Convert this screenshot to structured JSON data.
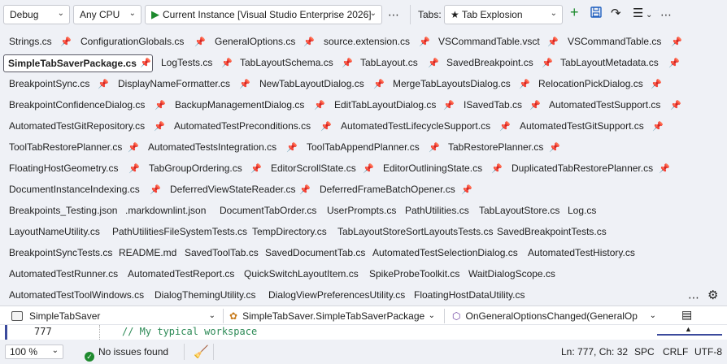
{
  "toolbar": {
    "config": "Debug",
    "platform": "Any CPU",
    "run_target": "Current Instance [Visual Studio Enterprise 2026]",
    "tabs_label": "Tabs:",
    "tab_set": "★ Tab Explosion"
  },
  "tab_rows": [
    [
      {
        "label": "Strings.cs",
        "pinned": true
      },
      {
        "label": "ConfigurationGlobals.cs",
        "pinned": true
      },
      {
        "label": "GeneralOptions.cs",
        "pinned": true
      },
      {
        "label": "source.extension.cs",
        "pinned": true
      },
      {
        "label": "VSCommandTable.vsct",
        "pinned": true
      },
      {
        "label": "VSCommandTable.cs",
        "pinned": true
      }
    ],
    [
      {
        "label": "SimpleTabSaverPackage.cs",
        "pinned": true,
        "active": true
      },
      {
        "label": "LogTests.cs",
        "pinned": true
      },
      {
        "label": "TabLayoutSchema.cs",
        "pinned": true
      },
      {
        "label": "TabLayout.cs",
        "pinned": true
      },
      {
        "label": "SavedBreakpoint.cs",
        "pinned": true
      },
      {
        "label": "TabLayoutMetadata.cs",
        "pinned": true
      }
    ],
    [
      {
        "label": "BreakpointSync.cs",
        "pinned": true
      },
      {
        "label": "DisplayNameFormatter.cs",
        "pinned": true
      },
      {
        "label": "NewTabLayoutDialog.cs",
        "pinned": true
      },
      {
        "label": "MergeTabLayoutsDialog.cs",
        "pinned": true
      },
      {
        "label": "RelocationPickDialog.cs",
        "pinned": true
      }
    ],
    [
      {
        "label": "BreakpointConfidenceDialog.cs",
        "pinned": true
      },
      {
        "label": "BackupManagementDialog.cs",
        "pinned": true
      },
      {
        "label": "EditTabLayoutDialog.cs",
        "pinned": true
      },
      {
        "label": "ISavedTab.cs",
        "pinned": true
      },
      {
        "label": "AutomatedTestSupport.cs",
        "pinned": true
      }
    ],
    [
      {
        "label": "AutomatedTestGitRepository.cs",
        "pinned": true
      },
      {
        "label": "AutomatedTestPreconditions.cs",
        "pinned": true
      },
      {
        "label": "AutomatedTestLifecycleSupport.cs",
        "pinned": true
      },
      {
        "label": "AutomatedTestGitSupport.cs",
        "pinned": true
      }
    ],
    [
      {
        "label": "ToolTabRestorePlanner.cs",
        "pinned": true
      },
      {
        "label": "AutomatedTestsIntegration.cs",
        "pinned": true
      },
      {
        "label": "ToolTabAppendPlanner.cs",
        "pinned": true
      },
      {
        "label": "TabRestorePlanner.cs",
        "pinned": true
      }
    ],
    [
      {
        "label": "FloatingHostGeometry.cs",
        "pinned": true
      },
      {
        "label": "TabGroupOrdering.cs",
        "pinned": true
      },
      {
        "label": "EditorScrollState.cs",
        "pinned": true
      },
      {
        "label": "EditorOutliningState.cs",
        "pinned": true
      },
      {
        "label": "DuplicatedTabRestorePlanner.cs",
        "pinned": true
      }
    ],
    [
      {
        "label": "DocumentInstanceIndexing.cs",
        "pinned": true
      },
      {
        "label": "DeferredViewStateReader.cs",
        "pinned": true
      },
      {
        "label": "DeferredFrameBatchOpener.cs",
        "pinned": true
      }
    ],
    [
      {
        "label": "Breakpoints_Testing.json",
        "pinned": false
      },
      {
        "label": ".markdownlint.json",
        "pinned": false
      },
      {
        "label": "DocumentTabOrder.cs",
        "pinned": false
      },
      {
        "label": "UserPrompts.cs",
        "pinned": false
      },
      {
        "label": "PathUtilities.cs",
        "pinned": false
      },
      {
        "label": "TabLayoutStore.cs",
        "pinned": false
      },
      {
        "label": "Log.cs",
        "pinned": false
      }
    ],
    [
      {
        "label": "LayoutNameUtility.cs",
        "pinned": false
      },
      {
        "label": "PathUtilitiesFileSystemTests.cs",
        "pinned": false
      },
      {
        "label": "TempDirectory.cs",
        "pinned": false
      },
      {
        "label": "TabLayoutStoreSortLayoutsTests.cs",
        "pinned": false
      },
      {
        "label": "SavedBreakpointTests.cs",
        "pinned": false
      }
    ],
    [
      {
        "label": "BreakpointSyncTests.cs",
        "pinned": false
      },
      {
        "label": "README.md",
        "pinned": false
      },
      {
        "label": "SavedToolTab.cs",
        "pinned": false
      },
      {
        "label": "SavedDocumentTab.cs",
        "pinned": false
      },
      {
        "label": "AutomatedTestSelectionDialog.cs",
        "pinned": false
      },
      {
        "label": "AutomatedTestHistory.cs",
        "pinned": false
      }
    ],
    [
      {
        "label": "AutomatedTestRunner.cs",
        "pinned": false
      },
      {
        "label": "AutomatedTestReport.cs",
        "pinned": false
      },
      {
        "label": "QuickSwitchLayoutItem.cs",
        "pinned": false
      },
      {
        "label": "SpikeProbeToolkit.cs",
        "pinned": false
      },
      {
        "label": "WaitDialogScope.cs",
        "pinned": false
      }
    ],
    [
      {
        "label": "AutomatedTestToolWindows.cs",
        "pinned": false
      },
      {
        "label": "DialogThemingUtility.cs",
        "pinned": false
      },
      {
        "label": "DialogViewPreferencesUtility.cs",
        "pinned": false
      },
      {
        "label": "FloatingHostDataUtility.cs",
        "pinned": false
      }
    ]
  ],
  "navbar": {
    "project": "SimpleTabSaver",
    "type": "SimpleTabSaver.SimpleTabSaverPackage",
    "member": "OnGeneralOptionsChanged(GeneralOp"
  },
  "editor": {
    "line_number": "777",
    "code": "// My typical workspace"
  },
  "status": {
    "zoom": "100 %",
    "issues": "No issues found",
    "position": "Ln: 777, Ch: 32",
    "whitespace": "SPC",
    "line_ending": "CRLF",
    "encoding": "UTF-8"
  },
  "colors": {
    "accent": "#3b4a9c",
    "run": "#1e8a2e",
    "background": "#eff1f6"
  },
  "icons": [
    "play-icon",
    "pin-icon",
    "add-icon",
    "save-icon",
    "share-icon",
    "menu-icon",
    "gear-icon",
    "broom-icon",
    "split-icon",
    "check-icon"
  ]
}
